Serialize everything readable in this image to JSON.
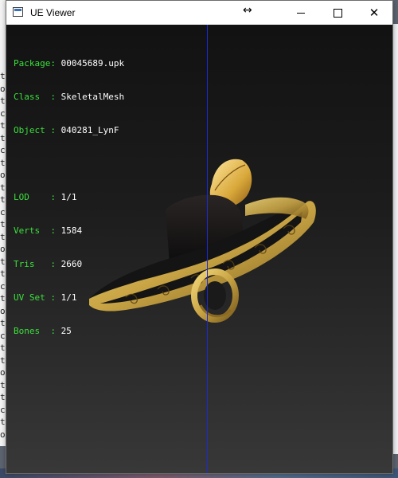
{
  "window": {
    "title": "UE Viewer",
    "controls": {
      "minimize": "minimize",
      "maximize": "maximize",
      "close": "close"
    }
  },
  "background": {
    "console_glyphs": [
      "t",
      "o",
      "t",
      "c",
      "t",
      "t",
      "c",
      "t",
      "o",
      "t",
      "t",
      "c",
      "t",
      "t",
      "o",
      "t",
      "t",
      "c",
      "t",
      "o",
      "t",
      "c",
      "t",
      "t",
      "o",
      "t",
      "t",
      "c",
      "t",
      "o"
    ]
  },
  "viewer": {
    "info": {
      "package": {
        "label": "Package:",
        "value": "00045689.upk"
      },
      "class": {
        "label": "Class  :",
        "value": "SkeletalMesh"
      },
      "object": {
        "label": "Object :",
        "value": "040281_LynF"
      },
      "lod": {
        "label": "LOD    :",
        "value": "1/1"
      },
      "verts": {
        "label": "Verts  :",
        "value": "1584"
      },
      "tris": {
        "label": "Tris   :",
        "value": "2660"
      },
      "uvset": {
        "label": "UV Set :",
        "value": "1/1"
      },
      "bones": {
        "label": "Bones  :",
        "value": "25"
      }
    },
    "colors": {
      "label": "#3ce03c",
      "value": "#ffffff",
      "axis": "#1b2bd8",
      "gold": "#c9a545"
    }
  }
}
